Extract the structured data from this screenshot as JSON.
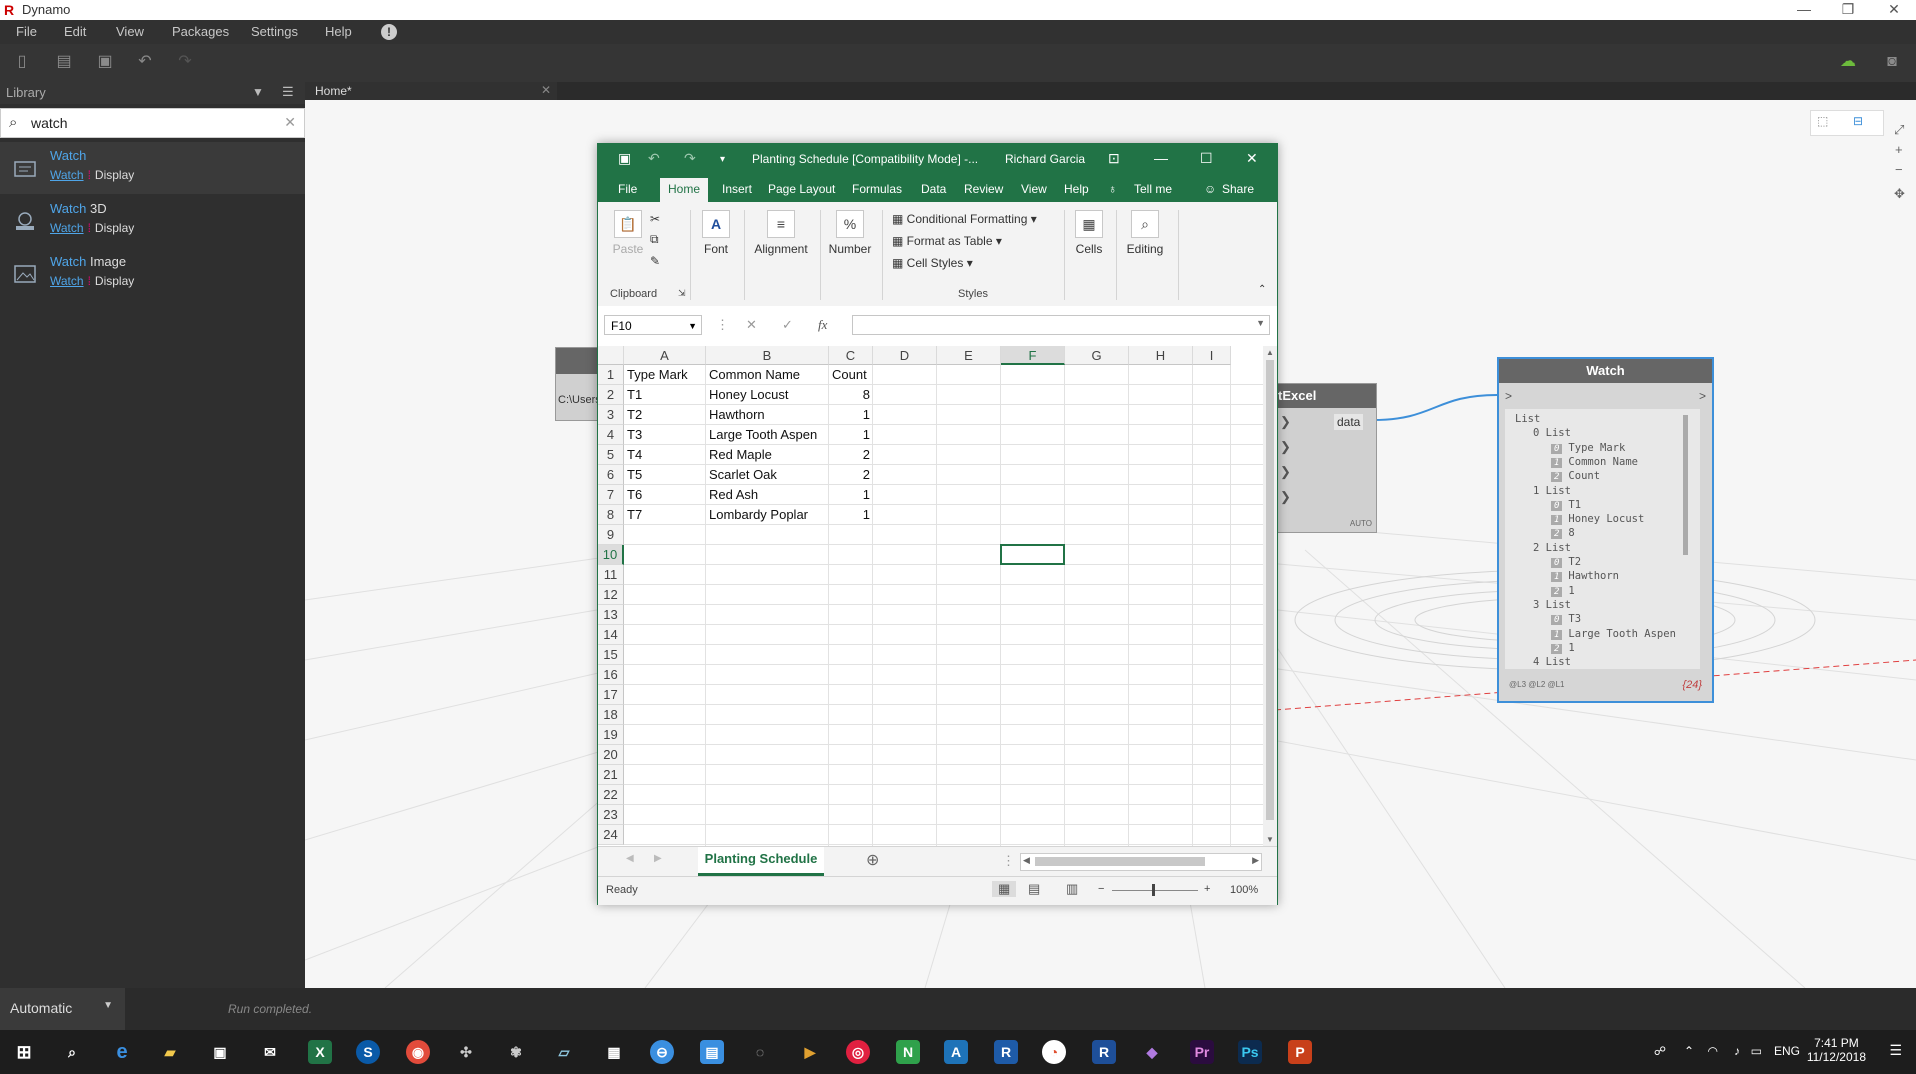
{
  "app": {
    "title": "Dynamo"
  },
  "menu": [
    "File",
    "Edit",
    "View",
    "Packages",
    "Settings",
    "Help"
  ],
  "library": {
    "label": "Library",
    "search_value": "watch",
    "items": [
      {
        "name": "Watch",
        "name_suffix": "",
        "category": "Watch",
        "subcategory": "Display"
      },
      {
        "name": "Watch",
        "name_suffix": " 3D",
        "category": "Watch",
        "subcategory": "Display"
      },
      {
        "name": "Watch",
        "name_suffix": " Image",
        "category": "Watch",
        "subcategory": "Display"
      }
    ]
  },
  "workspace": {
    "tab": "Home*"
  },
  "status": {
    "run_mode": "Automatic",
    "message": "Run completed."
  },
  "nodes": {
    "file_path_stub": "C:\\Users",
    "excel_node": {
      "title_fragment": "tExcel",
      "output_port": "data",
      "lacing": "AUTO"
    },
    "watch": {
      "title": "Watch",
      "in_port": ">",
      "out_port": ">",
      "levels": "@L3 @L2 @L1",
      "count": "{24}",
      "tree": [
        {
          "depth": 0,
          "text": "List"
        },
        {
          "depth": 1,
          "text": "0 List"
        },
        {
          "depth": 2,
          "idx": "0",
          "text": "Type Mark"
        },
        {
          "depth": 2,
          "idx": "1",
          "text": "Common Name"
        },
        {
          "depth": 2,
          "idx": "2",
          "text": "Count"
        },
        {
          "depth": 1,
          "text": "1 List"
        },
        {
          "depth": 2,
          "idx": "0",
          "text": "T1"
        },
        {
          "depth": 2,
          "idx": "1",
          "text": "Honey Locust"
        },
        {
          "depth": 2,
          "idx": "2",
          "text": "8"
        },
        {
          "depth": 1,
          "text": "2 List"
        },
        {
          "depth": 2,
          "idx": "0",
          "text": "T2"
        },
        {
          "depth": 2,
          "idx": "1",
          "text": "Hawthorn"
        },
        {
          "depth": 2,
          "idx": "2",
          "text": "1"
        },
        {
          "depth": 1,
          "text": "3 List"
        },
        {
          "depth": 2,
          "idx": "0",
          "text": "T3"
        },
        {
          "depth": 2,
          "idx": "1",
          "text": "Large Tooth Aspen"
        },
        {
          "depth": 2,
          "idx": "2",
          "text": "1"
        },
        {
          "depth": 1,
          "text": "4 List"
        }
      ]
    }
  },
  "excel": {
    "title": "Planting Schedule  [Compatibility Mode]  -...",
    "user": "Richard Garcia",
    "tabs": [
      "File",
      "Home",
      "Insert",
      "Page Layout",
      "Formulas",
      "Data",
      "Review",
      "View",
      "Help",
      "Tell me",
      "Share"
    ],
    "active_tab": "Home",
    "ribbon": {
      "paste": "Paste",
      "clipboard": "Clipboard",
      "font": "Font",
      "alignment": "Alignment",
      "number": "Number",
      "conditional": "Conditional Formatting",
      "format_table": "Format as Table",
      "cell_styles": "Cell Styles",
      "styles": "Styles",
      "cells": "Cells",
      "editing": "Editing"
    },
    "name_box": "F10",
    "fx": "fx",
    "columns": [
      "A",
      "B",
      "C",
      "D",
      "E",
      "F",
      "G",
      "H",
      "I"
    ],
    "rows": [
      [
        "Type Mark",
        "Common Name",
        "Count"
      ],
      [
        "T1",
        "Honey Locust",
        "8"
      ],
      [
        "T2",
        "Hawthorn",
        "1"
      ],
      [
        "T3",
        "Large Tooth Aspen",
        "1"
      ],
      [
        "T4",
        "Red Maple",
        "2"
      ],
      [
        "T5",
        "Scarlet Oak",
        "2"
      ],
      [
        "T6",
        "Red Ash",
        "1"
      ],
      [
        "T7",
        "Lombardy Poplar",
        "1"
      ]
    ],
    "row_count": 24,
    "selected_cell": "F10",
    "sheet_tab": "Planting Schedule",
    "status_ready": "Ready",
    "zoom": "100%"
  },
  "taskbar": {
    "time": "7:41 PM",
    "date": "11/12/2018",
    "lang": "ENG"
  }
}
